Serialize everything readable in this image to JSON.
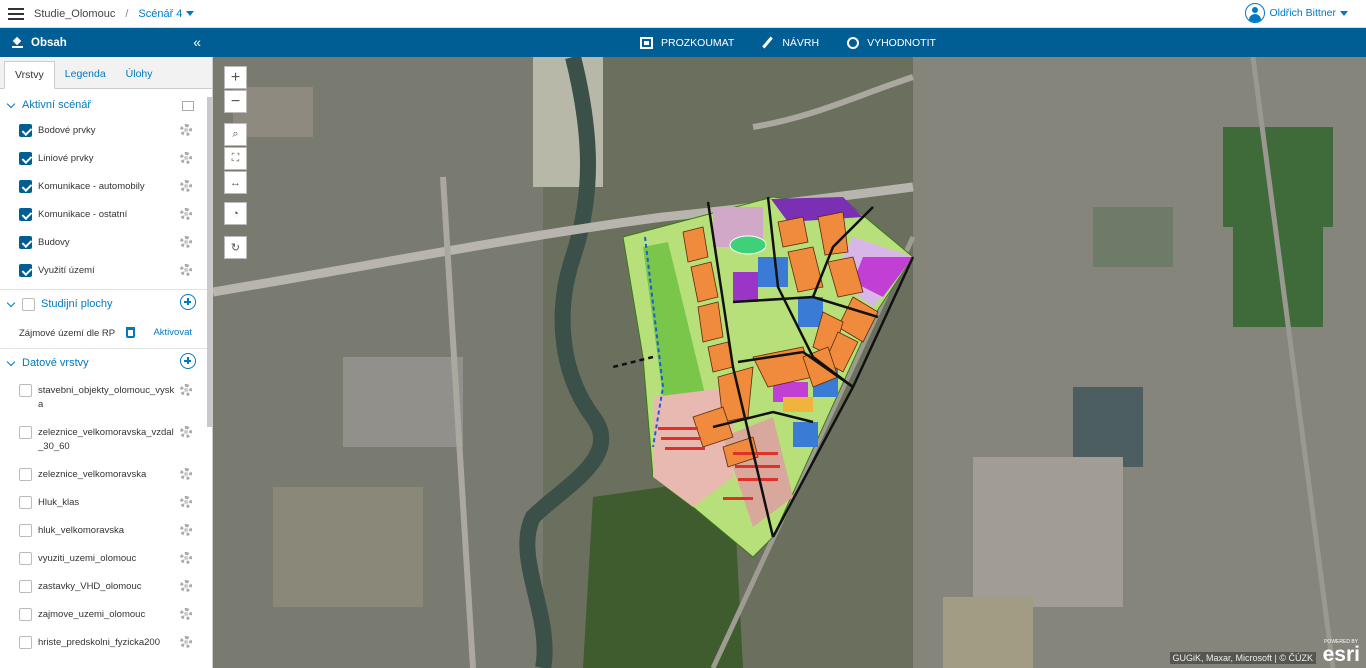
{
  "topbar": {
    "project": "Studie_Olomouc",
    "separator": "/",
    "scenario": "Scénář 4",
    "user": "Oldřich Bittner"
  },
  "panel": {
    "title": "Obsah"
  },
  "modes": [
    {
      "label": "PROZKOUMAT",
      "icon": "explore-icon"
    },
    {
      "label": "NÁVRH",
      "icon": "pen-icon"
    },
    {
      "label": "VYHODNOTIT",
      "icon": "evaluate-icon"
    }
  ],
  "tabs": [
    {
      "label": "Vrstvy",
      "active": true
    },
    {
      "label": "Legenda",
      "active": false
    },
    {
      "label": "Úlohy",
      "active": false
    }
  ],
  "sections": {
    "active": "Aktivní scénář",
    "study": "Studijní plochy",
    "data": "Datové vrstvy"
  },
  "active_layers": [
    {
      "label": "Bodové prvky",
      "checked": true
    },
    {
      "label": "Liniové prvky",
      "checked": true
    },
    {
      "label": "Komunikace - automobily",
      "checked": true
    },
    {
      "label": "Komunikace - ostatní",
      "checked": true
    },
    {
      "label": "Budovy",
      "checked": true
    },
    {
      "label": "Využití území",
      "checked": true
    }
  ],
  "study_area": {
    "label": "Zájmové území dle RP",
    "action": "Aktivovat"
  },
  "data_layers": [
    {
      "label": "stavebni_objekty_olomouc_vyska",
      "checked": false
    },
    {
      "label": "zeleznice_velkomoravska_vzdal_30_60",
      "checked": false
    },
    {
      "label": "zeleznice_velkomoravska",
      "checked": false
    },
    {
      "label": "Hluk_klas",
      "checked": false
    },
    {
      "label": "hluk_velkomoravska",
      "checked": false
    },
    {
      "label": "vyuziti_uzemi_olomouc",
      "checked": false
    },
    {
      "label": "zastavky_VHD_olomouc",
      "checked": false
    },
    {
      "label": "zajmove_uzemi_olomouc",
      "checked": false
    },
    {
      "label": "hriste_predskolni_fyzicka200",
      "checked": false
    }
  ],
  "map": {
    "zoom_in": "+",
    "zoom_out": "−",
    "attribution": "GUGiK, Maxar, Microsoft | © ČÚZK",
    "logo": "esri",
    "logo_caption": "POWERED BY"
  },
  "colors": {
    "brand": "#005e95",
    "accent": "#0079c1",
    "buildings": "#f08a3c",
    "green": "#8ccf5a",
    "sport": "#c9a2c8",
    "commerce": "#c040d8",
    "school": "#3a7bd5"
  }
}
